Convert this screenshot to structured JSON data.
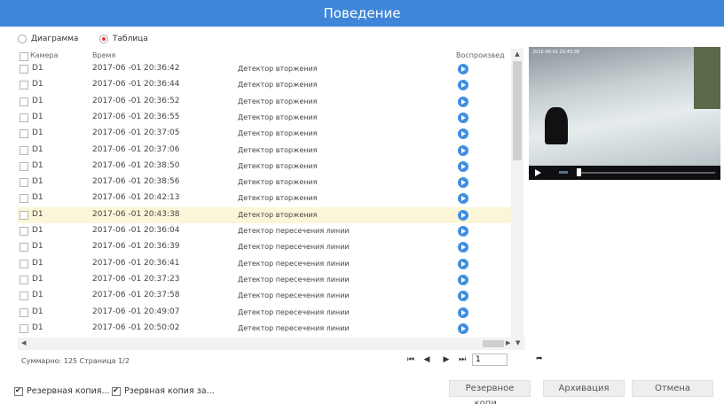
{
  "window": {
    "title": "Поведение"
  },
  "mode": {
    "diagram_label": "Диаграмма",
    "table_label": "Таблица",
    "selected": "Таблица"
  },
  "table": {
    "headers": {
      "camera": "Камера",
      "time": "Время",
      "playback": "Воспроизвед"
    },
    "rows": [
      {
        "camera": "D1",
        "time": "2017-06 -01  20:36:42",
        "event": "Детектор вторжения"
      },
      {
        "camera": "D1",
        "time": "2017-06 -01  20:36:44",
        "event": "Детектор вторжения"
      },
      {
        "camera": "D1",
        "time": "2017-06 -01  20:36:52",
        "event": "Детектор вторжения"
      },
      {
        "camera": "D1",
        "time": "2017-06 -01  20:36:55",
        "event": "Детектор вторжения"
      },
      {
        "camera": "D1",
        "time": "2017-06 -01  20:37:05",
        "event": "Детектор вторжения"
      },
      {
        "camera": "D1",
        "time": "2017-06 -01  20:37:06",
        "event": "Детектор вторжения"
      },
      {
        "camera": "D1",
        "time": "2017-06 -01  20:38:50",
        "event": "Детектор вторжения"
      },
      {
        "camera": "D1",
        "time": "2017-06 -01  20:38:56",
        "event": "Детектор вторжения"
      },
      {
        "camera": "D1",
        "time": "2017-06 -01  20:42:13",
        "event": "Детектор вторжения"
      },
      {
        "camera": "D1",
        "time": "2017-06 -01  20:43:38",
        "event": "Детектор вторжения",
        "selected": true
      },
      {
        "camera": "D1",
        "time": "2017-06 -01  20:36:04",
        "event": "Детектор пересечения линии"
      },
      {
        "camera": "D1",
        "time": "2017-06 -01  20:36:39",
        "event": "Детектор пересечения линии"
      },
      {
        "camera": "D1",
        "time": "2017-06 -01  20:36:41",
        "event": "Детектор пересечения линии"
      },
      {
        "camera": "D1",
        "time": "2017-06 -01  20:37:23",
        "event": "Детектор пересечения линии"
      },
      {
        "camera": "D1",
        "time": "2017-06 -01  20:37:58",
        "event": "Детектор пересечения линии"
      },
      {
        "camera": "D1",
        "time": "2017-06 -01  20:49:07",
        "event": "Детектор пересечения линии"
      },
      {
        "camera": "D1",
        "time": "2017-06 -01  20:50:02",
        "event": "Детектор пересечения линии"
      }
    ]
  },
  "video": {
    "osd_text": "2016-08-01 20:43:38"
  },
  "summary": "Суммарно: 125 Страница 1/2",
  "pager": {
    "page_value": "1"
  },
  "checkboxes": {
    "backup1": "Резервная копия...",
    "backup2": "Рзервная копия за..."
  },
  "buttons": {
    "backup": "Резервное копи...",
    "archive": "Архивация",
    "cancel": "Отмена"
  },
  "colors": {
    "accent": "#3f86d8",
    "play_icon": "#3f8fe0",
    "selected_row": "#fbf6d8"
  }
}
